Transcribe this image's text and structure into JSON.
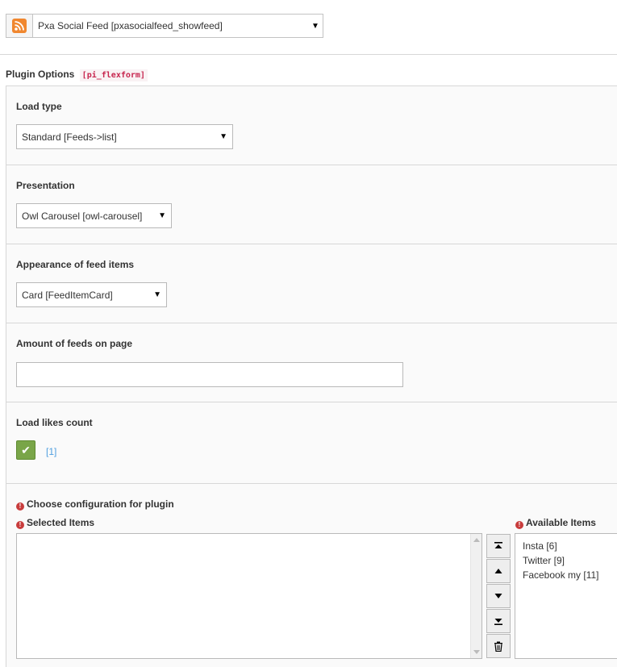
{
  "plugin": {
    "selected": "Pxa Social Feed [pxasocialfeed_showfeed]",
    "icon": "rss-icon"
  },
  "plugin_options": {
    "title": "Plugin Options",
    "code": "[pi_flexform]"
  },
  "fields": {
    "load_type": {
      "label": "Load type",
      "value": "Standard [Feeds->list]"
    },
    "presentation": {
      "label": "Presentation",
      "value": "Owl Carousel [owl-carousel]"
    },
    "appearance": {
      "label": "Appearance of feed items",
      "value": "Card [FeedItemCard]"
    },
    "amount": {
      "label": "Amount of feeds on page",
      "value": ""
    },
    "likes": {
      "label": "Load likes count",
      "checked": true,
      "option_label": "[1]"
    }
  },
  "configuration": {
    "label": "Choose configuration for plugin",
    "selected_label": "Selected Items",
    "available_label": "Available Items",
    "available_items": [
      "Insta [6]",
      "Twitter [9]",
      "Facebook my [11]"
    ]
  },
  "colors": {
    "checkbox": "#79a548",
    "error": "#c83c3c",
    "code": "#c7254e"
  }
}
